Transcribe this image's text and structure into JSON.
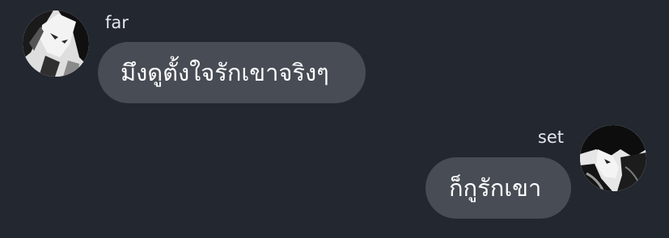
{
  "chat": {
    "messages": [
      {
        "sender": "far",
        "text": "มึงดูตั้งใจรักเขาจริงๆ",
        "avatar_icon": "manga-character-avatar",
        "side": "left"
      },
      {
        "sender": "set",
        "text": "ก็กูรักเขา",
        "avatar_icon": "manga-character-avatar",
        "side": "right"
      }
    ]
  },
  "colors": {
    "background": "#232730",
    "bubble": "#474c55",
    "text": "#ffffff",
    "sender_name": "#e4e6ea"
  }
}
